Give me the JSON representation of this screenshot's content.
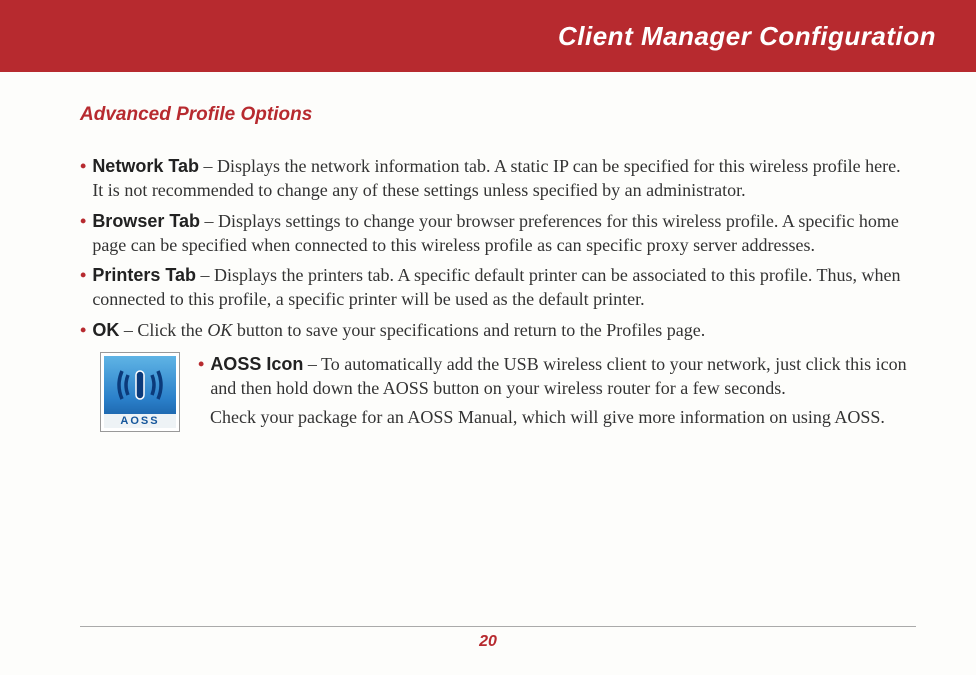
{
  "header": {
    "title": "Client Manager Configuration"
  },
  "section": {
    "title": "Advanced Profile Options"
  },
  "items": [
    {
      "label": "Network Tab",
      "text": " –  Displays the network information tab.  A static IP can be specified for this wireless profile here.  It is not recommended to change any of these settings unless specified by an administrator."
    },
    {
      "label": "Browser Tab",
      "text": " –  Displays settings to change your browser preferences for this wireless profile.  A specific home page can be specified when connected to this wireless profile as can specific proxy server addresses."
    },
    {
      "label": "Printers Tab",
      "text": " –  Displays the printers tab.  A specific default printer can be associated to this profile.  Thus, when connected to this profile, a specific printer will be used as the default printer."
    },
    {
      "label": "OK",
      "text_prefix": " – Click the ",
      "text_italic": "OK",
      "text_suffix": " button to save your specifications and return to the Profiles page."
    }
  ],
  "aoss": {
    "icon_caption": "AOSS",
    "label": "AOSS Icon",
    "text": " –  To automatically add the USB wireless client to your network, just click this icon and then hold down the AOSS button on your wireless router for a few seconds.",
    "followup": "Check your package for an AOSS Manual, which will give more information on using AOSS."
  },
  "page_number": "20"
}
